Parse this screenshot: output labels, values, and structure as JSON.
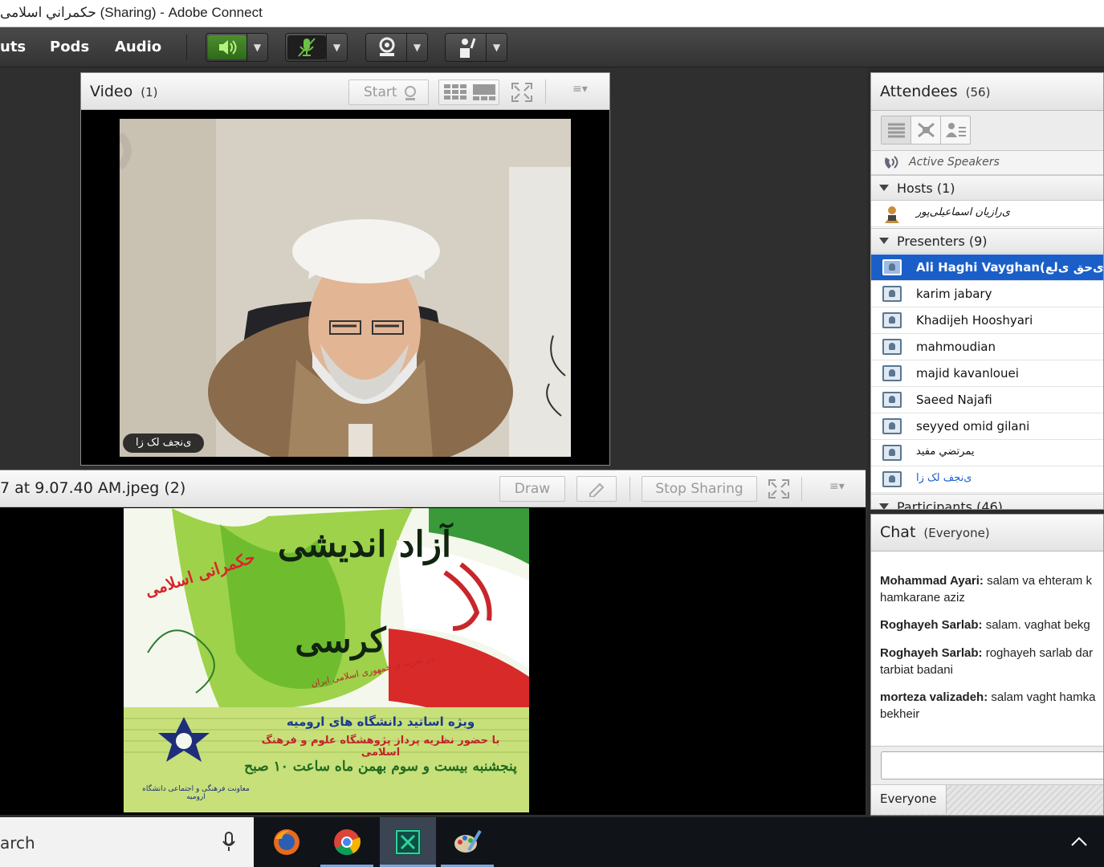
{
  "window": {
    "title": "حكمراني اسلامی (Sharing) - Adobe Connect"
  },
  "menubar": {
    "items": [
      "uts",
      "Pods",
      "Audio"
    ],
    "tools": [
      {
        "icon": "speaker-icon"
      },
      {
        "icon": "microphone-muted-icon"
      },
      {
        "icon": "webcam-icon"
      },
      {
        "icon": "raise-hand-icon"
      }
    ]
  },
  "video_pod": {
    "title": "Video",
    "count": "(1)",
    "start_label": "Start",
    "participant_label": "ی‌نجف لک زا"
  },
  "share_pod": {
    "title": "7 at 9.07.40 AM.jpeg (2)",
    "draw_label": "Draw",
    "stop_sharing_label": "Stop Sharing",
    "poster": {
      "title_main": "آزاد اندیشی",
      "title_prefix": "کرسی",
      "subtitle": "حکمرانی اسلامی",
      "tagline": "در تجربه ی جمهوری اسلامی ایران",
      "line1": "ویژه اساتید دانشگاه های ارومیه",
      "line2": "با حضور نظریه پرداز پژوهشگاه علوم و فرهنگ اسلامی",
      "line3": "پنجشنبه بیست و سوم بهمن ماه ساعت ۱۰ صبح",
      "org": "معاونت فرهنگی و اجتماعی دانشگاه ارومیه"
    }
  },
  "attendees": {
    "title": "Attendees",
    "count": "(56)",
    "active_speakers_label": "Active Speakers",
    "hosts_label": "Hosts (1)",
    "hosts": [
      "ی‌رازیان اسماعیلی‌پور"
    ],
    "presenters_label": "Presenters (9)",
    "presenters": [
      "Ali Haghi Vayghan(ی‌حق ی‌لع)",
      "karim jabary",
      "Khadijeh Hooshyari",
      "mahmoudian",
      "majid kavanlouei",
      "Saeed Najafi",
      "seyyed omid gilani",
      "یمرتضي مفيد",
      "ی‌نجف لک زا"
    ],
    "participants_label": "Participants (46)"
  },
  "chat": {
    "title": "Chat",
    "scope": "(Everyone)",
    "messages": [
      {
        "sender": "Mohammad Ayari:",
        "text": " salam va ehteram k hamkarane aziz"
      },
      {
        "sender": "Roghayeh Sarlab:",
        "text": " salam. vaghat bekg"
      },
      {
        "sender": "Roghayeh Sarlab:",
        "text": " roghayeh sarlab dar tarbiat badani"
      },
      {
        "sender": "morteza valizadeh:",
        "text": " salam vaght hamka bekheir"
      }
    ],
    "recipient_label": "Everyone"
  },
  "taskbar": {
    "search_text": "arch",
    "apps": [
      "firefox-icon",
      "chrome-icon",
      "adobe-connect-icon",
      "paint-icon"
    ]
  },
  "colors": {
    "selected_row": "#1a5fc8",
    "speaker_green": "#62c43c",
    "taskbar": "#101318"
  }
}
